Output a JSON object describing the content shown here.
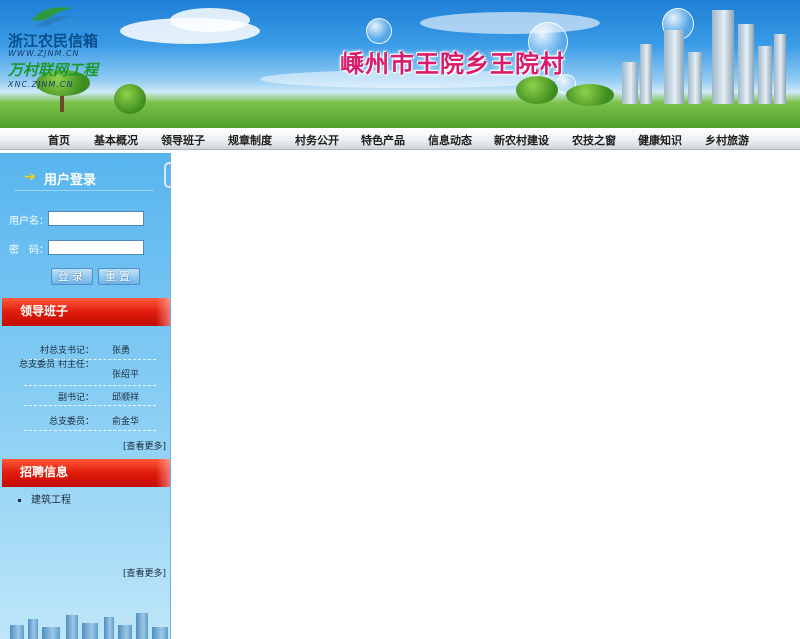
{
  "logo": {
    "emblem": "green-leaf-logo",
    "line1": "浙江农民信箱",
    "url1": "WWW.ZJNM.CN",
    "line2": "万村联网工程",
    "url2": "XNC.ZJNM.CN"
  },
  "site_title": "嵊州市王院乡王院村",
  "nav": {
    "items": [
      "首页",
      "基本概况",
      "领导班子",
      "规章制度",
      "村务公开",
      "特色产品",
      "信息动态",
      "新农村建设",
      "农技之窗",
      "健康知识",
      "乡村旅游"
    ]
  },
  "login": {
    "icon": "arrow-icon",
    "title": "用户登录",
    "username_label": "用户名：",
    "password_label": "密　码：",
    "username_value": "",
    "password_value": "",
    "login_button": "登录",
    "reset_button": "重置"
  },
  "leaders": {
    "title": "领导班子",
    "rows": [
      {
        "role": "村总支书记：",
        "name": "张勇"
      },
      {
        "role": "总支委员 村主任：",
        "name": "张绍平"
      },
      {
        "role": "副书记：",
        "name": "邱顺祥"
      },
      {
        "role": "总支委员：",
        "name": "俞金华"
      }
    ],
    "more": "[查看更多]"
  },
  "jobs": {
    "title": "招聘信息",
    "items": [
      "建筑工程"
    ],
    "more": "[查看更多]"
  },
  "colors": {
    "title_pink": "#d81b6a",
    "sidebar_blue": "#57b5ee",
    "section_red": "#e01c0c"
  }
}
